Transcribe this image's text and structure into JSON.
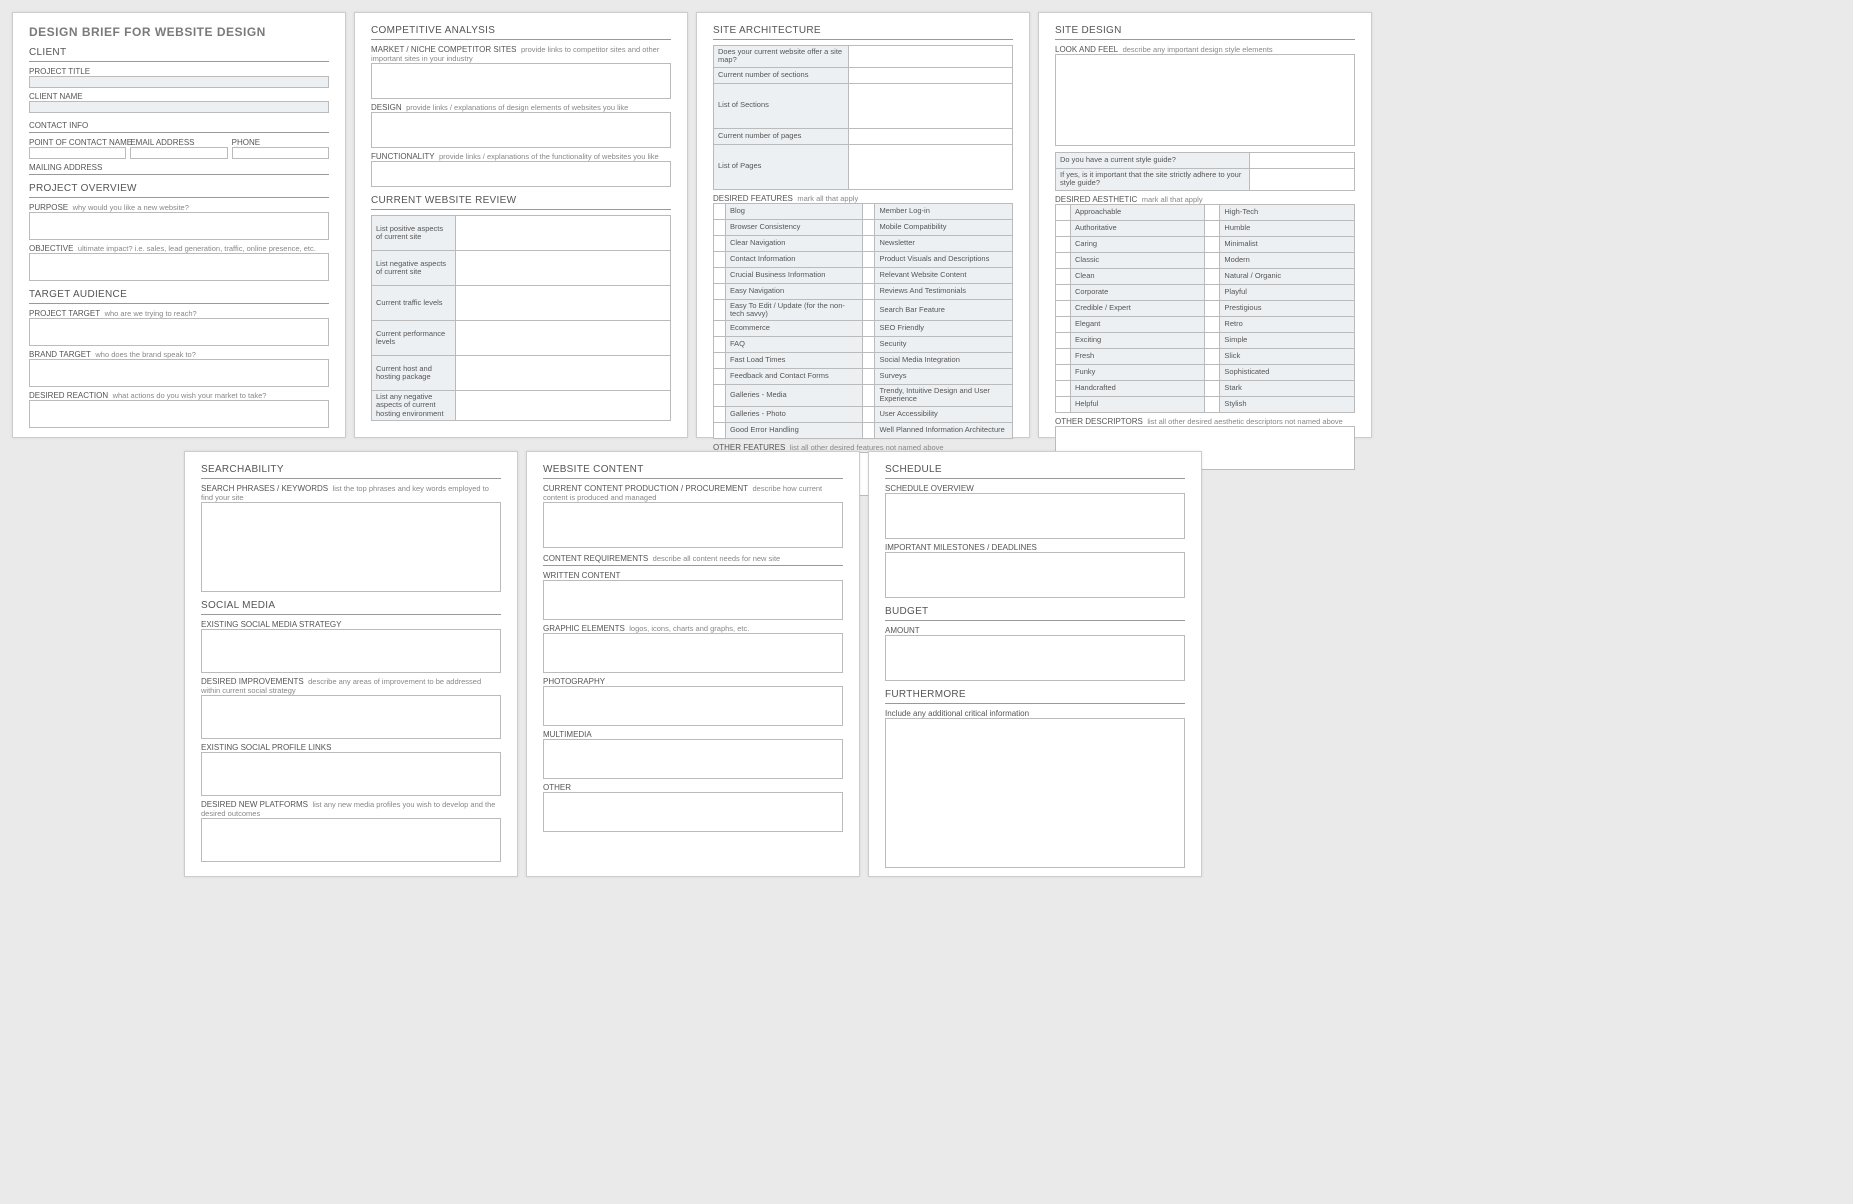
{
  "doc": {
    "title": "DESIGN BRIEF FOR WEBSITE DESIGN"
  },
  "client": {
    "heading": "CLIENT",
    "projectTitle": "PROJECT TITLE",
    "clientName": "CLIENT NAME",
    "contactInfo": "CONTACT INFO",
    "poc": "POINT OF CONTACT NAME",
    "email": "EMAIL ADDRESS",
    "phone": "PHONE",
    "mailing": "MAILING ADDRESS"
  },
  "overview": {
    "heading": "PROJECT OVERVIEW",
    "purpose": "PURPOSE",
    "purposeHint": "why would you like a new website?",
    "objective": "OBJECTIVE",
    "objectiveHint": "ultimate impact?  i.e. sales, lead generation, traffic, online presence, etc."
  },
  "audience": {
    "heading": "TARGET AUDIENCE",
    "projTarget": "PROJECT TARGET",
    "projTargetHint": "who are we trying to reach?",
    "brandTarget": "BRAND TARGET",
    "brandTargetHint": "who does the brand speak to?",
    "reaction": "DESIRED REACTION",
    "reactionHint": "what actions do you wish your market to take?"
  },
  "competitive": {
    "heading": "COMPETITIVE ANALYSIS",
    "market": "MARKET / NICHE COMPETITOR SITES",
    "marketHint": "provide links to competitor sites and other important sites in your industry",
    "design": "DESIGN",
    "designHint": "provide links / explanations of design elements of websites you like",
    "func": "FUNCTIONALITY",
    "funcHint": "provide links / explanations of the functionality of websites you like"
  },
  "review": {
    "heading": "CURRENT WEBSITE REVIEW",
    "rows": [
      "List positive aspects of current site",
      "List negative aspects of current site",
      "Current traffic levels",
      "Current performance levels",
      "Current host and hosting package"
    ],
    "negHost": "List any negative aspects of current hosting environment"
  },
  "arch": {
    "heading": "SITE ARCHITECTURE",
    "sitemap": "Does your current website offer a site map?",
    "numSections": "Current number of sections",
    "listSections": "List of Sections",
    "numPages": "Current number of pages",
    "listPages": "List of Pages",
    "desired": "DESIRED FEATURES",
    "desiredHint": "mark all that apply",
    "featuresA": [
      "Blog",
      "Browser Consistency",
      "Clear Navigation",
      "Contact Information",
      "Crucial Business Information",
      "Easy Navigation",
      "Easy To Edit / Update (for the non-tech savvy)",
      "Ecommerce",
      "FAQ",
      "Fast Load Times",
      "Feedback and Contact Forms",
      "Galleries - Media",
      "Galleries - Photo",
      "Good Error Handling"
    ],
    "featuresB": [
      "Member Log-in",
      "Mobile Compatibility",
      "Newsletter",
      "Product Visuals and Descriptions",
      "Relevant Website Content",
      "Reviews And Testimonials",
      "Search Bar Feature",
      "SEO Friendly",
      "Security",
      "Social Media Integration",
      "Surveys",
      "Trendy, Intuitive Design and User Experience",
      "User Accessibility",
      "Well Planned Information Architecture"
    ],
    "other": "OTHER FEATURES",
    "otherHint": "list all other desired features not named above"
  },
  "design": {
    "heading": "SITE DESIGN",
    "look": "LOOK AND FEEL",
    "lookHint": "describe any important design style elements",
    "q1": "Do you have a current style guide?",
    "q2": "If yes, is it important that the site strictly adhere to your style guide?",
    "aesth": "DESIRED AESTHETIC",
    "aesthHint": "mark all that apply",
    "aesthA": [
      "Approachable",
      "Authoritative",
      "Caring",
      "Classic",
      "Clean",
      "Corporate",
      "Credible / Expert",
      "Elegant",
      "Exciting",
      "Fresh",
      "Funky",
      "Handcrafted",
      "Helpful"
    ],
    "aesthB": [
      "High-Tech",
      "Humble",
      "Minimalist",
      "Modern",
      "Natural / Organic",
      "Playful",
      "Prestigious",
      "Retro",
      "Simple",
      "Slick",
      "Sophisticated",
      "Stark",
      "Stylish"
    ],
    "other": "OTHER DESCRIPTORS",
    "otherHint": "list all other desired aesthetic descriptors not named above"
  },
  "search": {
    "heading": "SEARCHABILITY",
    "kw": "SEARCH PHRASES / KEYWORDS",
    "kwHint": "list the top phrases and key words employed to find your site"
  },
  "social": {
    "heading": "SOCIAL MEDIA",
    "existing": "EXISTING SOCIAL MEDIA STRATEGY",
    "improve": "DESIRED IMPROVEMENTS",
    "improveHint": "describe any areas of improvement to be addressed within current social strategy",
    "links": "EXISTING SOCIAL PROFILE LINKS",
    "newplat": "DESIRED NEW PLATFORMS",
    "newplatHint": "list any new media profiles you wish to develop and the desired outcomes"
  },
  "content": {
    "heading": "WEBSITE CONTENT",
    "current": "CURRENT CONTENT PRODUCTION / PROCUREMENT",
    "currentHint": "describe how current content is produced and managed",
    "req": "CONTENT REQUIREMENTS",
    "reqHint": "describe all content needs for new site",
    "written": "WRITTEN CONTENT",
    "graphic": "GRAPHIC ELEMENTS",
    "graphicHint": "logos, icons, charts and graphs, etc.",
    "photo": "PHOTOGRAPHY",
    "multi": "MULTIMEDIA",
    "other": "OTHER"
  },
  "schedule": {
    "heading": "SCHEDULE",
    "overview": "SCHEDULE OVERVIEW",
    "milestones": "IMPORTANT MILESTONES / DEADLINES"
  },
  "budget": {
    "heading": "BUDGET",
    "amount": "AMOUNT"
  },
  "more": {
    "heading": "FURTHERMORE",
    "hint": "Include any additional critical information"
  }
}
